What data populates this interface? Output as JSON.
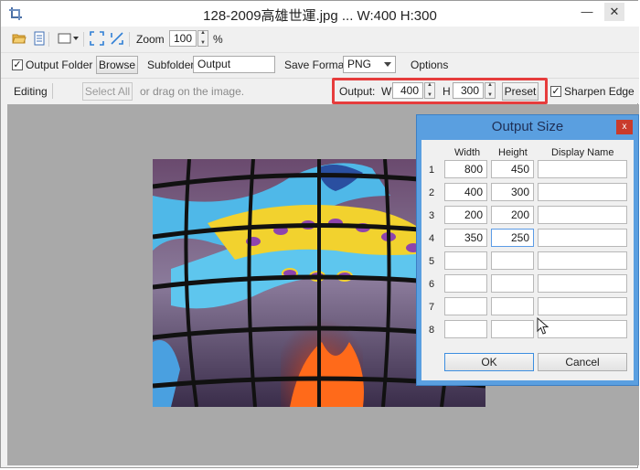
{
  "window": {
    "title": "128-2009高雄世運.jpg ... W:400 H:300",
    "minimize": "—",
    "close": "✕"
  },
  "toolbar1": {
    "zoom_label": "Zoom",
    "zoom_value": "100",
    "zoom_unit": "%"
  },
  "toolbar2": {
    "output_folder_label": "Output Folder",
    "browse_label": "Browse",
    "subfolder_label": "Subfolder",
    "subfolder_value": "Output",
    "save_format_label": "Save Format",
    "save_format_value": "PNG",
    "options_label": "Options"
  },
  "toolbar3": {
    "editing_label": "Editing",
    "select_all_label": "Select All",
    "drag_hint": "or drag on the image.",
    "output_label": "Output:",
    "w_label": "W",
    "w_value": "400",
    "h_label": "H",
    "h_value": "300",
    "preset_label": "Preset",
    "sharpen_label": "Sharpen Edge"
  },
  "dialog": {
    "title": "Output Size",
    "close": "x",
    "headers": {
      "width": "Width",
      "height": "Height",
      "display_name": "Display Name"
    },
    "rows": [
      {
        "n": "1",
        "w": "800",
        "h": "450",
        "name": ""
      },
      {
        "n": "2",
        "w": "400",
        "h": "300",
        "name": ""
      },
      {
        "n": "3",
        "w": "200",
        "h": "200",
        "name": ""
      },
      {
        "n": "4",
        "w": "350",
        "h": "250",
        "name": ""
      },
      {
        "n": "5",
        "w": "",
        "h": "",
        "name": ""
      },
      {
        "n": "6",
        "w": "",
        "h": "",
        "name": ""
      },
      {
        "n": "7",
        "w": "",
        "h": "",
        "name": ""
      },
      {
        "n": "8",
        "w": "",
        "h": "",
        "name": ""
      }
    ],
    "ok_label": "OK",
    "cancel_label": "Cancel"
  },
  "colors": {
    "highlight": "#e63c3c",
    "dialog_frame": "#5a9fe0",
    "canvas": "#a9a9a9"
  }
}
